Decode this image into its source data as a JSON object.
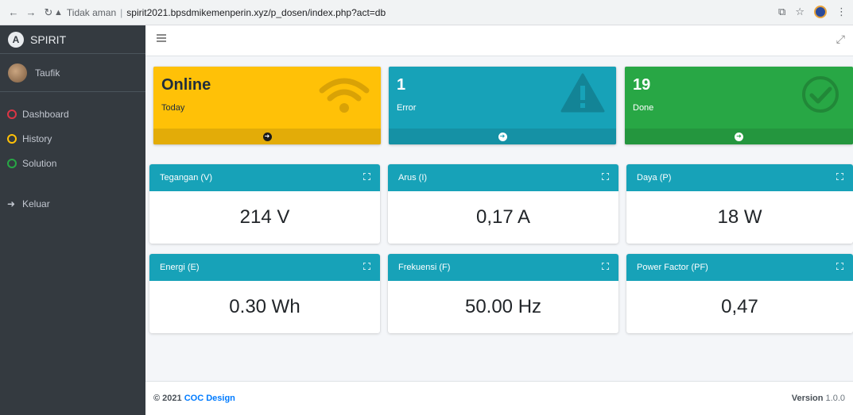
{
  "browser": {
    "not_secure": "Tidak aman",
    "url": "spirit2021.bpsdmikemenperin.xyz/p_dosen/index.php?act=db"
  },
  "sidebar": {
    "brand": "SPIRIT",
    "brand_logo": "A",
    "user": "Taufik",
    "items": [
      {
        "label": "Dashboard",
        "color": "#dc3545",
        "icon": "circle-outline-icon"
      },
      {
        "label": "History",
        "color": "#ffc107",
        "icon": "circle-outline-icon"
      },
      {
        "label": "Solution",
        "color": "#28a745",
        "icon": "circle-outline-icon"
      }
    ],
    "logout": "Keluar"
  },
  "stats": [
    {
      "value": "Online",
      "label": "Today",
      "icon": "wifi-icon",
      "color": "#ffc107"
    },
    {
      "value": "1",
      "label": "Error",
      "icon": "warning-icon",
      "color": "#17a2b8"
    },
    {
      "value": "19",
      "label": "Done",
      "icon": "check-circle-icon",
      "color": "#28a745"
    }
  ],
  "cards": [
    {
      "title": "Tegangan (V)",
      "value": "214 V"
    },
    {
      "title": "Arus (I)",
      "value": "0,17 A"
    },
    {
      "title": "Daya (P)",
      "value": "18 W"
    },
    {
      "title": "Energi (E)",
      "value": "0.30 Wh"
    },
    {
      "title": "Frekuensi (F)",
      "value": "50.00 Hz"
    },
    {
      "title": "Power Factor (PF)",
      "value": "0,47"
    }
  ],
  "footer": {
    "copyright": "© 2021",
    "brand": "COC Design",
    "version_label": "Version",
    "version": "1.0.0"
  }
}
